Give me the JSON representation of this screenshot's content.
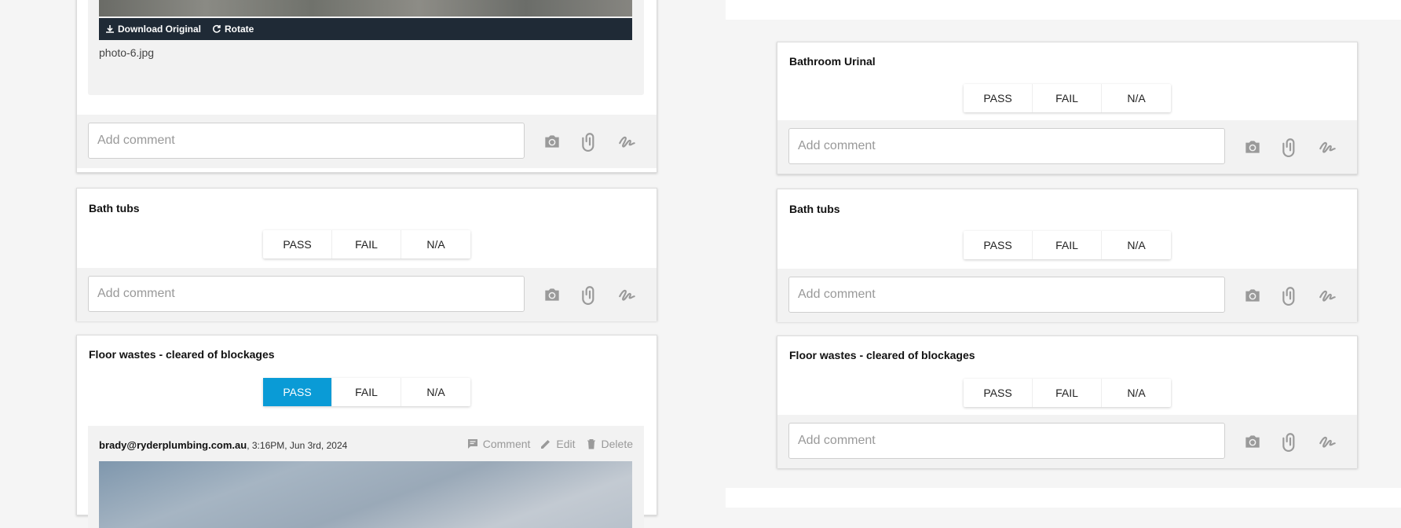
{
  "left": {
    "top_card": {
      "photo_toolbar": {
        "download_label": "Download Original",
        "rotate_label": "Rotate"
      },
      "photo_filename": "photo-6.jpg",
      "comment_placeholder": "Add comment"
    },
    "bath_tubs": {
      "title": "Bath tubs",
      "options": [
        "PASS",
        "FAIL",
        "N/A"
      ],
      "selected": null,
      "comment_placeholder": "Add comment"
    },
    "floor_wastes": {
      "title": "Floor wastes - cleared of blockages",
      "options": [
        "PASS",
        "FAIL",
        "N/A"
      ],
      "selected": "PASS",
      "note": {
        "author": "brady@ryderplumbing.com.au",
        "timestamp": ", 3:16PM, Jun 3rd, 2024",
        "comment_label": "Comment",
        "edit_label": "Edit",
        "delete_label": "Delete"
      }
    }
  },
  "right": {
    "bathroom_urinal": {
      "title": "Bathroom Urinal",
      "options": [
        "PASS",
        "FAIL",
        "N/A"
      ],
      "selected": null,
      "comment_placeholder": "Add comment"
    },
    "bath_tubs": {
      "title": "Bath tubs",
      "options": [
        "PASS",
        "FAIL",
        "N/A"
      ],
      "selected": null,
      "comment_placeholder": "Add comment"
    },
    "floor_wastes": {
      "title": "Floor wastes - cleared of blockages",
      "options": [
        "PASS",
        "FAIL",
        "N/A"
      ],
      "selected": null,
      "comment_placeholder": "Add comment"
    }
  },
  "colors": {
    "accent": "#0a9bd6",
    "toolbar": "#1f2a36"
  }
}
